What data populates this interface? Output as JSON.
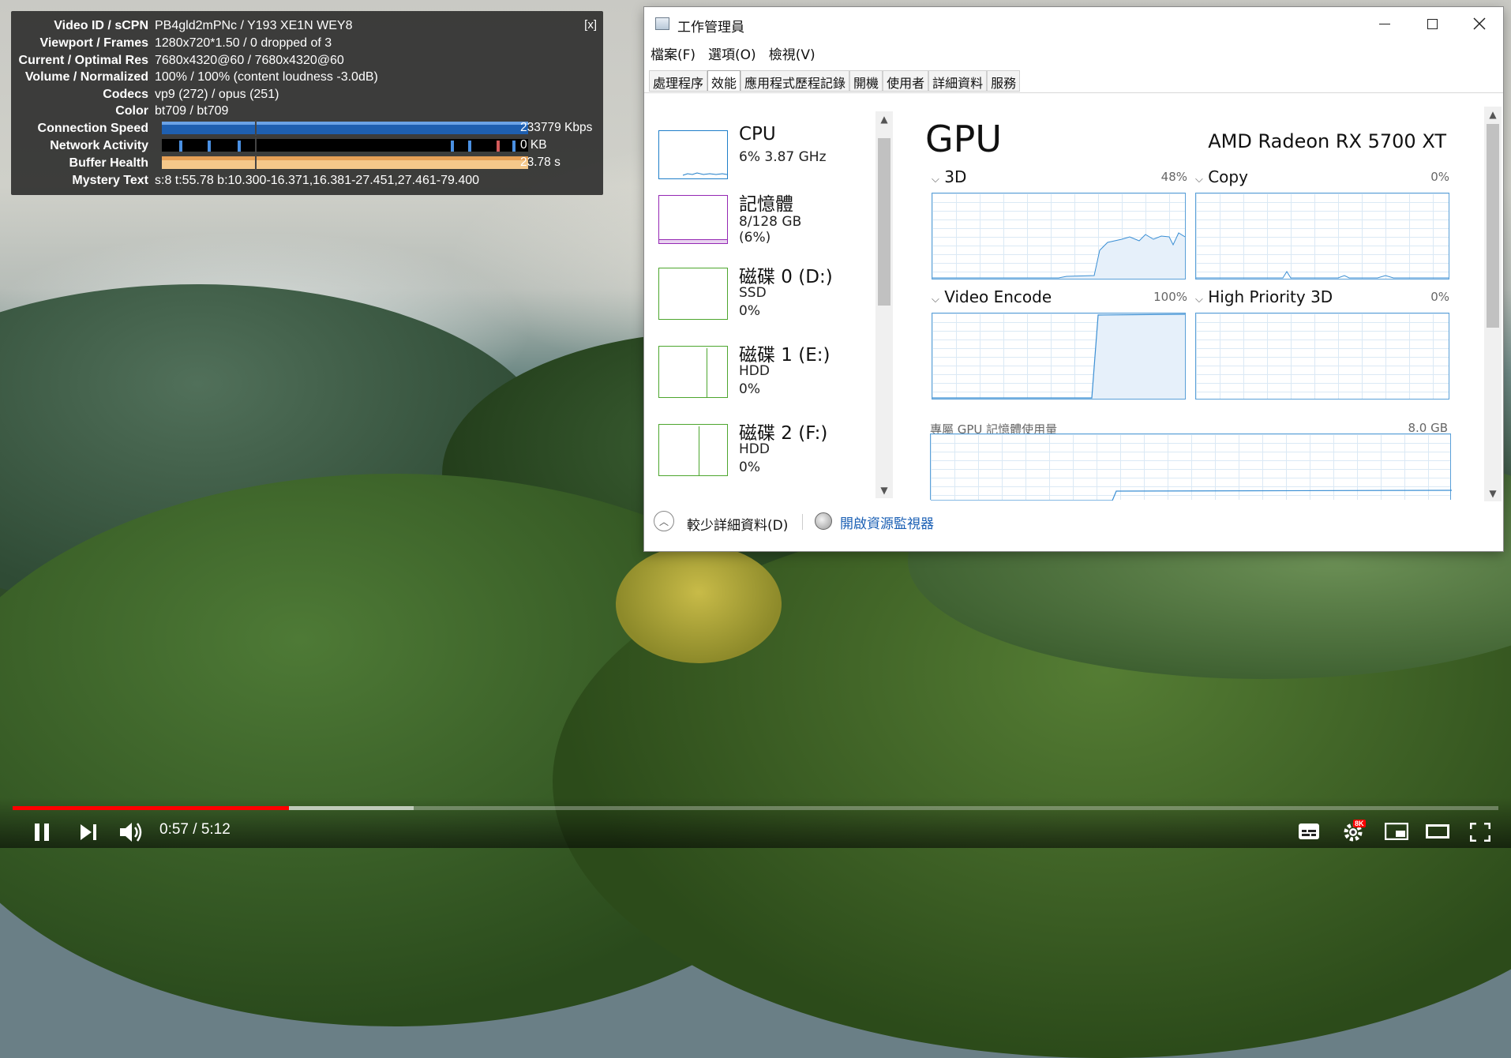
{
  "stats": {
    "close_label": "[x]",
    "rows": [
      {
        "k": "Video ID / sCPN",
        "v": "PB4gld2mPNc / Y193 XE1N WEY8"
      },
      {
        "k": "Viewport / Frames",
        "v": "1280x720*1.50 / 0 dropped of 3"
      },
      {
        "k": "Current / Optimal Res",
        "v": "7680x4320@60 / 7680x4320@60"
      },
      {
        "k": "Volume / Normalized",
        "v": "100% / 100% (content loudness -3.0dB)"
      },
      {
        "k": "Codecs",
        "v": "vp9 (272) / opus (251)"
      },
      {
        "k": "Color",
        "v": "bt709 / bt709"
      },
      {
        "k": "Connection Speed",
        "v": "233779 Kbps"
      },
      {
        "k": "Network Activity",
        "v": "0 KB"
      },
      {
        "k": "Buffer Health",
        "v": "23.78 s"
      },
      {
        "k": "Mystery Text",
        "v": "s:8 t:55.78 b:10.300-16.371,16.381-27.451,27.461-79.400"
      }
    ]
  },
  "taskmgr": {
    "title": "工作管理員",
    "menu": [
      "檔案(F)",
      "選項(O)",
      "檢視(V)"
    ],
    "tabs": [
      "處理程序",
      "效能",
      "應用程式歷程記錄",
      "開機",
      "使用者",
      "詳細資料",
      "服務"
    ],
    "active_tab": "效能",
    "resources": [
      {
        "name": "CPU",
        "sub1": "6%  3.87 GHz",
        "sub2": "",
        "color": "#1f7ec9"
      },
      {
        "name": "記憶體",
        "sub1": "8/128 GB (6%)",
        "sub2": "",
        "color": "#9528b4"
      },
      {
        "name": "磁碟 0 (D:)",
        "sub1": "SSD",
        "sub2": "0%",
        "color": "#4da62e"
      },
      {
        "name": "磁碟 1 (E:)",
        "sub1": "HDD",
        "sub2": "0%",
        "color": "#4da62e"
      },
      {
        "name": "磁碟 2 (F:)",
        "sub1": "HDD",
        "sub2": "0%",
        "color": "#4da62e"
      }
    ],
    "gpu_title": "GPU",
    "gpu_model": "AMD Radeon RX 5700 XT",
    "engines": [
      {
        "label": "3D",
        "pct": "48%"
      },
      {
        "label": "Copy",
        "pct": "0%"
      },
      {
        "label": "Video Encode",
        "pct": "100%"
      },
      {
        "label": "High Priority 3D",
        "pct": "0%"
      }
    ],
    "dedicated_mem_label": "專屬 GPU 記憶體使用量",
    "dedicated_mem_max": "8.0 GB",
    "less_details": "較少詳細資料(D)",
    "open_resource_monitor": "開啟資源監視器"
  },
  "player": {
    "time": "0:57 / 5:12",
    "quality_badge": "8K",
    "progress_played": 0.186,
    "progress_buffered": 0.27
  }
}
